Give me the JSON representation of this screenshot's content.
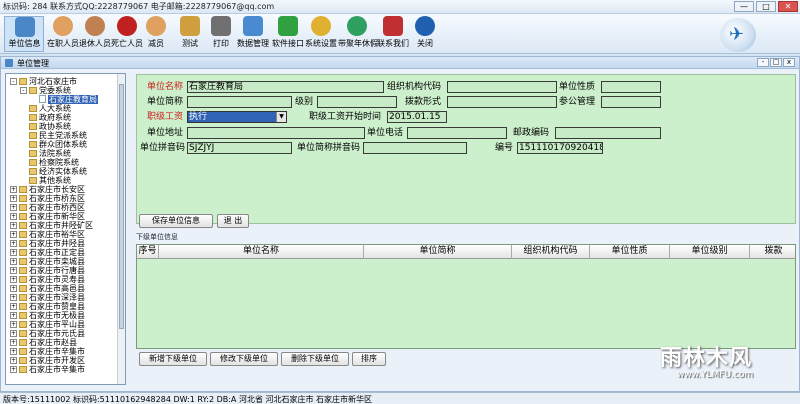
{
  "window": {
    "title": "标识码: 284 联系方式QQ:2228779067 电子邮箱:2228779067@qq.com",
    "min_label": "—",
    "max_label": "□",
    "close_label": "✕"
  },
  "toolbar": {
    "items": [
      {
        "label": "单位信息",
        "icon": "unit-info-icon",
        "color": "#4a87c7"
      },
      {
        "label": "在职人员",
        "icon": "employee-icon",
        "color": "#e0a060"
      },
      {
        "label": "退休人员",
        "icon": "retiree-icon",
        "color": "#c08050"
      },
      {
        "label": "死亡人员",
        "icon": "deceased-icon",
        "color": "#c02020"
      },
      {
        "label": "减员",
        "icon": "reduce-icon",
        "color": "#e0a060"
      },
      {
        "label": "测试",
        "icon": "test-icon",
        "color": "#d0a040"
      },
      {
        "label": "打印",
        "icon": "print-icon",
        "color": "#707070"
      },
      {
        "label": "数据管理",
        "icon": "data-manage-icon",
        "color": "#4a8ad0"
      },
      {
        "label": "软件接口",
        "icon": "software-interface-icon",
        "color": "#30a040"
      },
      {
        "label": "系统设置",
        "icon": "settings-icon",
        "color": "#e0b030"
      },
      {
        "label": "带聚年休假",
        "icon": "vacation-icon",
        "color": "#30a060"
      },
      {
        "label": "联系我们",
        "icon": "contact-icon",
        "color": "#c03030"
      },
      {
        "label": "关闭",
        "icon": "power-icon",
        "color": "#2060b0"
      }
    ]
  },
  "subwindow": {
    "title": "单位管理",
    "min_label": "-",
    "max_label": "□",
    "close_label": "x"
  },
  "tree": {
    "items": [
      {
        "label": "河北石家庄市",
        "level": 0,
        "toggle": "-"
      },
      {
        "label": "党委系统",
        "level": 1,
        "toggle": "-"
      },
      {
        "label": "石家庄教育局",
        "level": 2,
        "toggle": "",
        "selected": true
      },
      {
        "label": "人大系统",
        "level": 1,
        "toggle": ""
      },
      {
        "label": "政府系统",
        "level": 1,
        "toggle": ""
      },
      {
        "label": "政协系统",
        "level": 1,
        "toggle": ""
      },
      {
        "label": "民主党派系统",
        "level": 1,
        "toggle": ""
      },
      {
        "label": "群众团体系统",
        "level": 1,
        "toggle": ""
      },
      {
        "label": "法院系统",
        "level": 1,
        "toggle": ""
      },
      {
        "label": "检察院系统",
        "level": 1,
        "toggle": ""
      },
      {
        "label": "经济实体系统",
        "level": 1,
        "toggle": ""
      },
      {
        "label": "其他系统",
        "level": 1,
        "toggle": ""
      },
      {
        "label": "石家庄市长安区",
        "level": 0,
        "toggle": "+"
      },
      {
        "label": "石家庄市桥东区",
        "level": 0,
        "toggle": "+"
      },
      {
        "label": "石家庄市桥西区",
        "level": 0,
        "toggle": "+"
      },
      {
        "label": "石家庄市新华区",
        "level": 0,
        "toggle": "+"
      },
      {
        "label": "石家庄市井陉矿区",
        "level": 0,
        "toggle": "+"
      },
      {
        "label": "石家庄市裕华区",
        "level": 0,
        "toggle": "+"
      },
      {
        "label": "石家庄市井陉县",
        "level": 0,
        "toggle": "+"
      },
      {
        "label": "石家庄市正定县",
        "level": 0,
        "toggle": "+"
      },
      {
        "label": "石家庄市栾城县",
        "level": 0,
        "toggle": "+"
      },
      {
        "label": "石家庄市行唐县",
        "level": 0,
        "toggle": "+"
      },
      {
        "label": "石家庄市灵寿县",
        "level": 0,
        "toggle": "+"
      },
      {
        "label": "石家庄市高邑县",
        "level": 0,
        "toggle": "+"
      },
      {
        "label": "石家庄市深泽县",
        "level": 0,
        "toggle": "+"
      },
      {
        "label": "石家庄市赞皇县",
        "level": 0,
        "toggle": "+"
      },
      {
        "label": "石家庄市无极县",
        "level": 0,
        "toggle": "+"
      },
      {
        "label": "石家庄市平山县",
        "level": 0,
        "toggle": "+"
      },
      {
        "label": "石家庄市元氏县",
        "level": 0,
        "toggle": "+"
      },
      {
        "label": "石家庄市赵县",
        "level": 0,
        "toggle": "+"
      },
      {
        "label": "石家庄市辛集市",
        "level": 0,
        "toggle": "+"
      },
      {
        "label": "石家庄市开发区",
        "level": 0,
        "toggle": "+"
      },
      {
        "label": "石家庄市辛集市",
        "level": 0,
        "toggle": "+"
      }
    ]
  },
  "form": {
    "unit_name_label": "单位名称",
    "unit_name_value": "石家庄教育局",
    "org_code_label": "组织机构代码",
    "org_code_value": "",
    "unit_nature_label": "单位性质",
    "unit_nature_value": "",
    "short_name_label": "单位简称",
    "short_name_value": "",
    "level_label": "级别",
    "level_value": "",
    "funding_label": "拨款形式",
    "funding_value": "",
    "civil_mgmt_label": "参公管理",
    "civil_mgmt_value": "",
    "rank_salary_label": "职级工资",
    "rank_salary_value": "执行",
    "rank_start_label": "职级工资开始时间",
    "rank_start_value": "2015.01.15",
    "address_label": "单位地址",
    "address_value": "",
    "phone_label": "单位电话",
    "phone_value": "",
    "postcode_label": "邮政编码",
    "postcode_value": "",
    "pinyin_label": "单位拼音码",
    "pinyin_value": "SJZJYJ",
    "short_pinyin_label": "单位简称拼音码",
    "short_pinyin_value": "",
    "serial_label": "编号",
    "serial_value": "151110170920418"
  },
  "actions": {
    "save_label": "保存单位信息",
    "exit_label": "退 出"
  },
  "subunits": {
    "section_label": "下级单位信息",
    "columns": [
      "序号",
      "单位名称",
      "单位简称",
      "组织机构代码",
      "单位性质",
      "单位级别",
      "拨款"
    ],
    "rows": []
  },
  "bottom_buttons": {
    "add_label": "新增下级单位",
    "edit_label": "修改下级单位",
    "delete_label": "删除下级单位",
    "sort_label": "排序"
  },
  "watermark": {
    "text": "雨林木风",
    "url": "www.YLMFU.com"
  },
  "status": {
    "text": "版本号:15111002 标识码:5111016294828​4 DW:1 RY:2 DB:A 河北省 河北石家庄市 石家庄市新华区"
  }
}
